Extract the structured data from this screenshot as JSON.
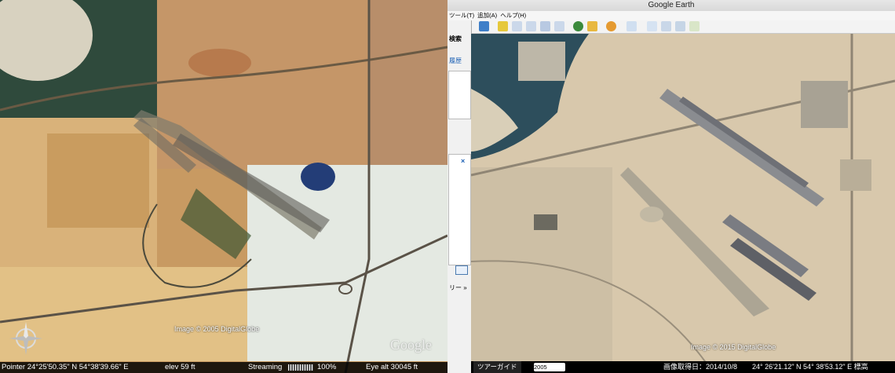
{
  "window": {
    "title": "Google Earth"
  },
  "menu": [
    "ツール(T)",
    "追加(A)",
    "ヘルプ(H)"
  ],
  "sidebar": {
    "search_label": "検索",
    "history_label": "履歴",
    "close_glyph": "×",
    "layers_label": "リー »"
  },
  "left_view": {
    "credit": "Image © 2005 DigitalGlobe",
    "watermark": "Google",
    "status": {
      "pointer": "Pointer  24°25'50.35\" N   54°38'39.66\" E",
      "elev": "elev  59 ft",
      "streaming": "Streaming",
      "streaming_pct": "100%",
      "eye_alt": "Eye  alt   30045 ft"
    }
  },
  "right_view": {
    "credit": "Image © 2015 DigitalGlobe",
    "tour_button": "ツアーガイド",
    "history_year": "2005",
    "status": {
      "capture_date": "画像取得日：2014/10/8",
      "coords": "24° 26'21.12\" N  54° 38'53.12\" E  標高"
    }
  },
  "colors": {
    "status_bg": "#000000",
    "accent": "#1a5fb4"
  }
}
